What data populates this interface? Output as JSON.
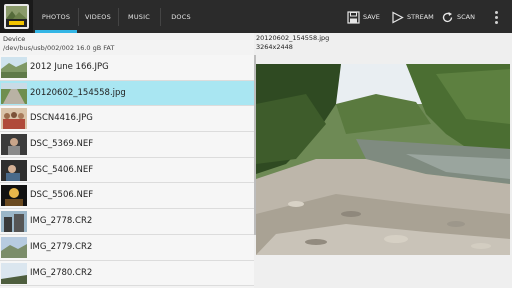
{
  "tabs": [
    {
      "label": "PHOTOS",
      "active": true
    },
    {
      "label": "VIDEOS",
      "active": false
    },
    {
      "label": "MUSIC",
      "active": false
    },
    {
      "label": "DOCS",
      "active": false
    }
  ],
  "actions": {
    "save": "SAVE",
    "stream": "STREAM",
    "scan": "SCAN"
  },
  "device": {
    "title": "Device",
    "path": "/dev/bus/usb/002/002 16.0 gB FAT"
  },
  "files": [
    {
      "name": "2012 June 166.JPG",
      "icon": "landscape-thumbnail"
    },
    {
      "name": "20120602_154558.jpg",
      "icon": "road-thumbnail",
      "selected": true
    },
    {
      "name": "DSCN4416.JPG",
      "icon": "people-thumbnail"
    },
    {
      "name": "DSC_5369.NEF",
      "icon": "portrait-thumbnail"
    },
    {
      "name": "DSC_5406.NEF",
      "icon": "portrait-thumbnail"
    },
    {
      "name": "DSC_5506.NEF",
      "icon": "concert-thumbnail"
    },
    {
      "name": "IMG_2778.CR2",
      "icon": "building-thumbnail"
    },
    {
      "name": "IMG_2779.CR2",
      "icon": "landscape-thumbnail"
    },
    {
      "name": "IMG_2780.CR2",
      "icon": "sky-thumbnail"
    }
  ],
  "preview": {
    "filename": "20120602_154558.jpg",
    "dimensions": "3264x2448"
  },
  "colors": {
    "accent": "#33b5e5",
    "selected_row": "#a9e6f2",
    "topbar": "#2b2b2b"
  }
}
